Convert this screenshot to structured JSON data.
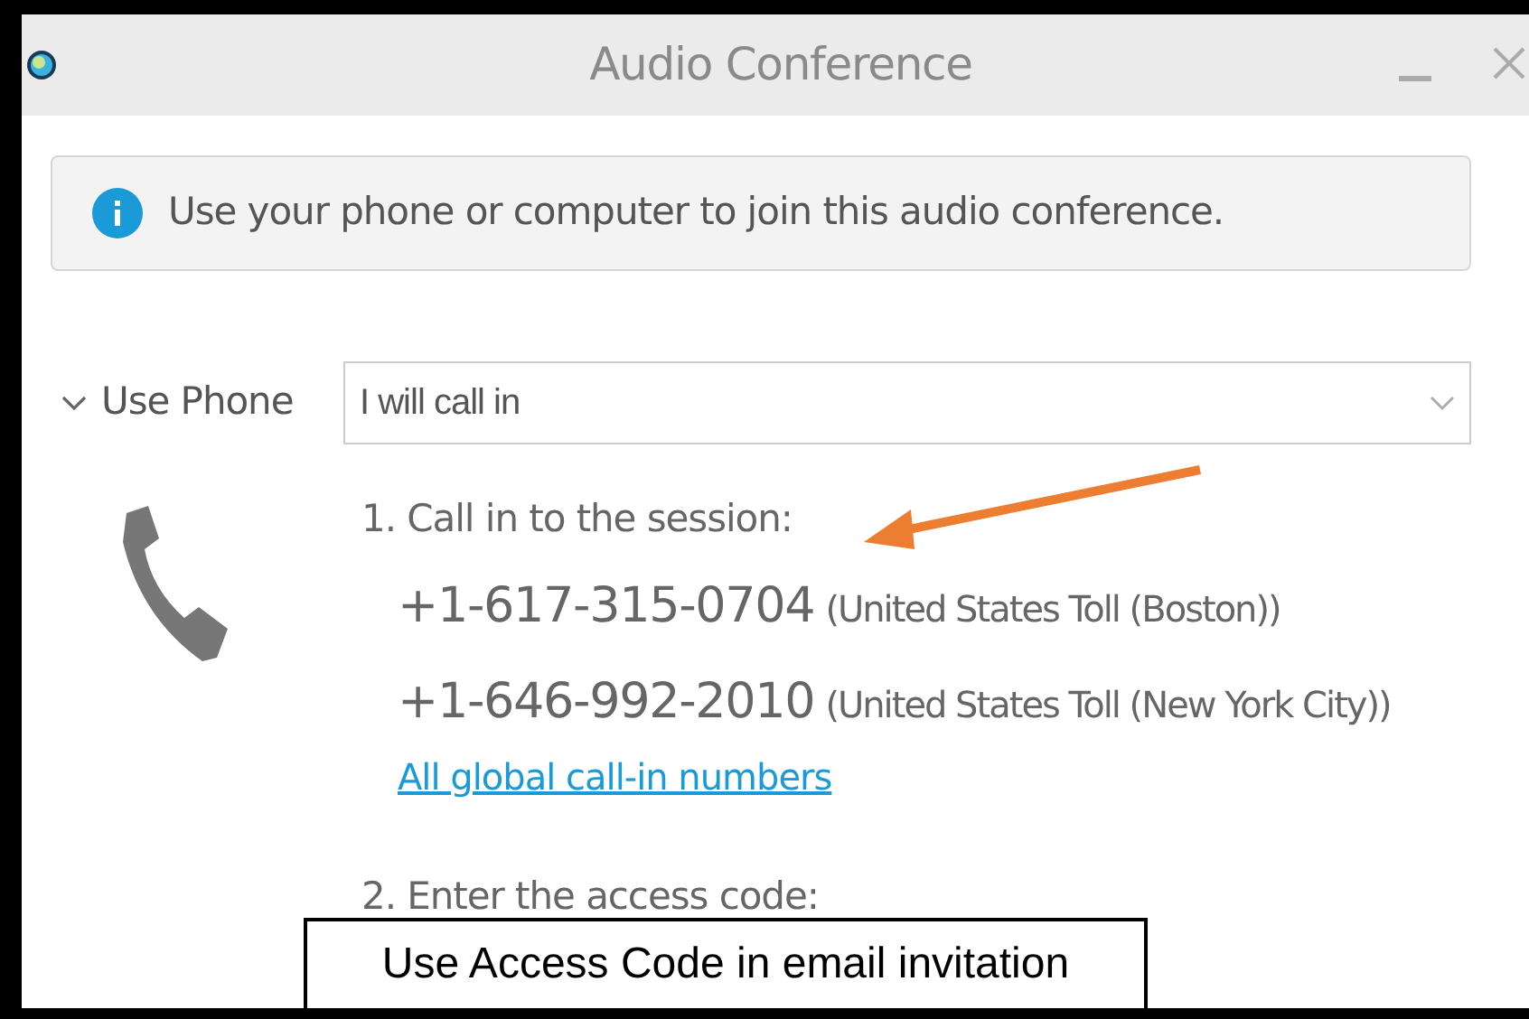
{
  "window": {
    "title": "Audio Conference"
  },
  "info_banner": {
    "text": "Use your phone or computer to join this audio conference."
  },
  "phone_section": {
    "label": "Use Phone",
    "expanded": true,
    "dropdown": {
      "value": "I will call in"
    },
    "steps": [
      {
        "kind": "call_in",
        "text": "1. Call in to the session:",
        "numbers": [
          {
            "number": "+1-617-315-0704",
            "description": "(United States Toll (Boston))"
          },
          {
            "number": "+1-646-992-2010",
            "description": "(United States Toll (New York City))"
          }
        ],
        "link": "All global call-in numbers"
      },
      {
        "kind": "access_code",
        "text": "2. Enter the access code:"
      }
    ]
  },
  "annotation": {
    "text": "Use Access Code in email invitation"
  }
}
